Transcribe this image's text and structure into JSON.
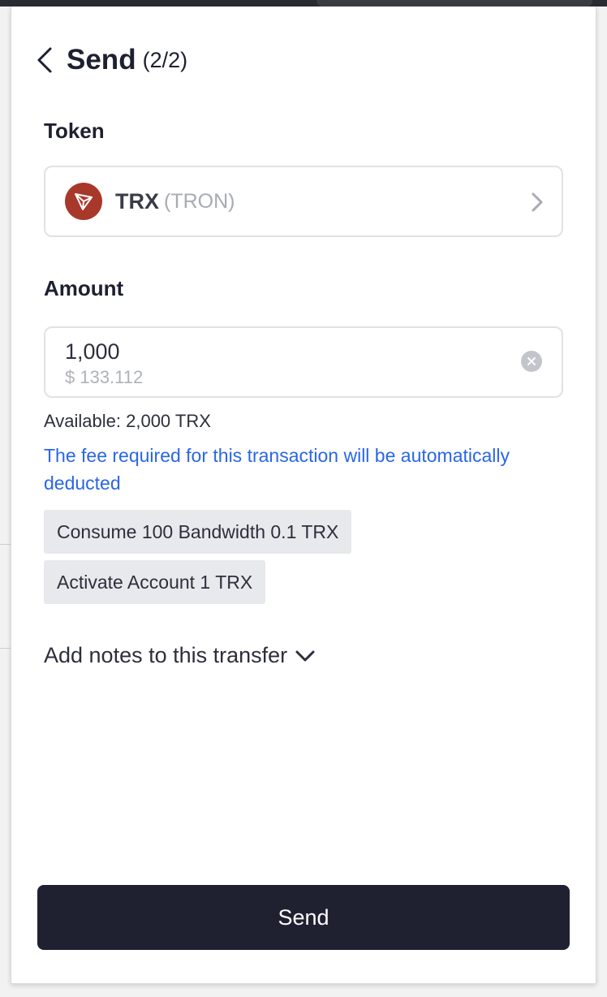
{
  "header": {
    "title": "Send",
    "step": "(2/2)"
  },
  "token": {
    "label": "Token",
    "symbol": "TRX",
    "network": "(TRON)",
    "logo_color": "#a8382a"
  },
  "amount": {
    "label": "Amount",
    "value": "1,000",
    "usd_value": "$ 133.112"
  },
  "available": "Available: 2,000 TRX",
  "fee_note": "The fee required for this transaction will be automatically deducted",
  "fee_chips": [
    "Consume 100 Bandwidth 0.1 TRX",
    "Activate Account 1 TRX"
  ],
  "notes_toggle": "Add notes to this transfer",
  "send_button": "Send",
  "colors": {
    "accent_blue": "#2a66e6",
    "primary_dark": "#1f2131"
  }
}
